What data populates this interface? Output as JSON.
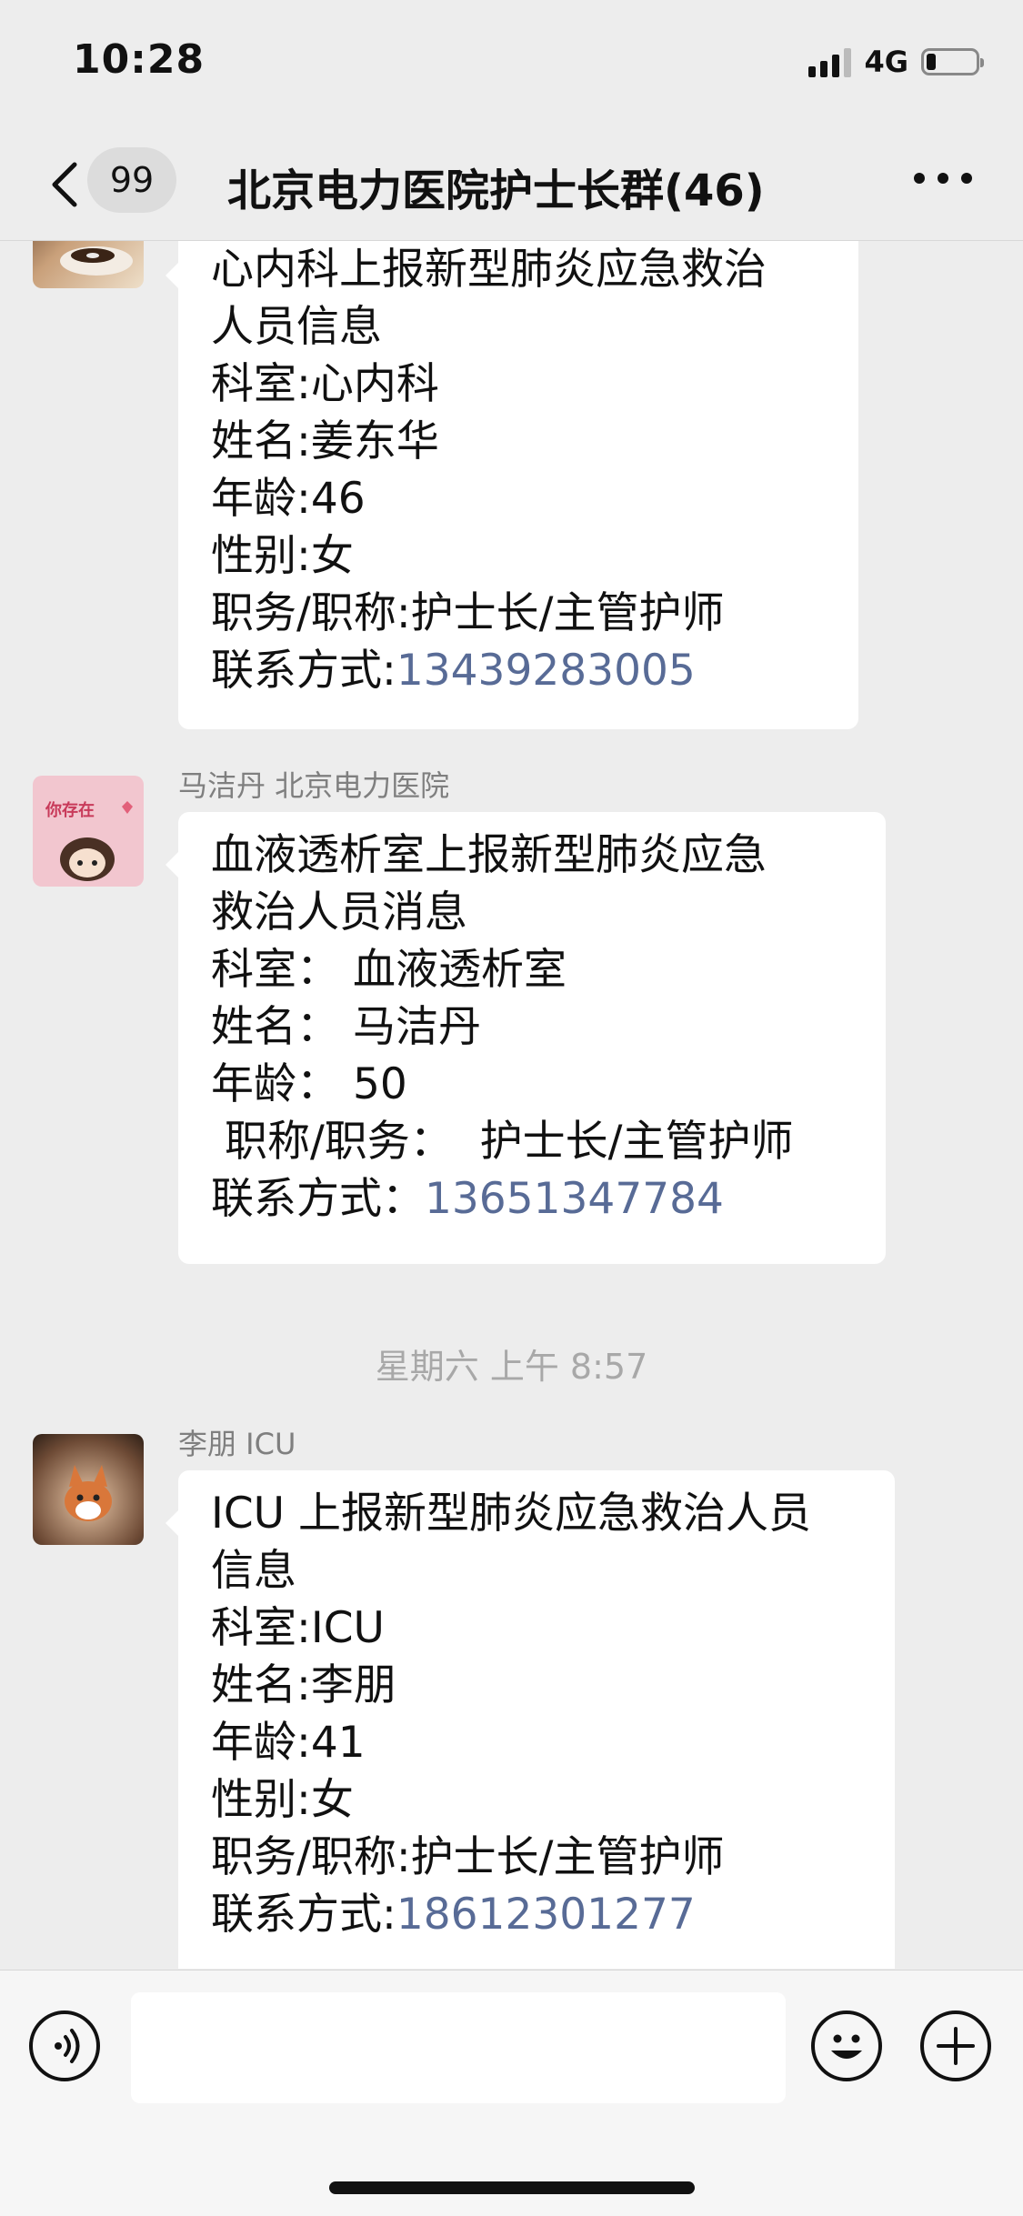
{
  "status_bar": {
    "time": "10:28",
    "network": "4G",
    "battery_level": 0.2
  },
  "nav": {
    "unread_count": "99",
    "title": "北京电力医院护士长群(46)"
  },
  "messages": [
    {
      "sender": "",
      "lines": [
        "心内科上报新型肺炎应急救治",
        "人员信息",
        "科室:心内科",
        "姓名:姜东华",
        "年龄:46",
        "性别:女",
        "职务/职称:护士长/主管护师"
      ],
      "contact_label": "联系方式:",
      "phone": "13439283005"
    },
    {
      "sender": "马洁丹 北京电力医院",
      "avatar_text": "你存在",
      "lines": [
        "血液透析室上报新型肺炎应急",
        "救治人员消息",
        "科室：  血液透析室",
        "姓名：  马洁丹",
        "年龄：  50",
        " 职称/职务：  护士长/主管护师"
      ],
      "contact_label": "联系方式：",
      "phone": "13651347784"
    },
    {
      "sender": "李朋 ICU",
      "lines": [
        "ICU 上报新型肺炎应急救治人员",
        "信息",
        "科室:ICU",
        "姓名:李朋",
        "年龄:41",
        "性别:女",
        "职务/职称:护士长/主管护师"
      ],
      "contact_label": "联系方式:",
      "phone": "18612301277"
    }
  ],
  "timestamp": "星期六 上午 8:57",
  "input_bar": {
    "placeholder": ""
  },
  "icons": {
    "back": "chevron-left-icon",
    "more": "more-dots-icon",
    "voice": "voice-icon",
    "emoji": "emoji-icon",
    "plus": "plus-icon"
  }
}
